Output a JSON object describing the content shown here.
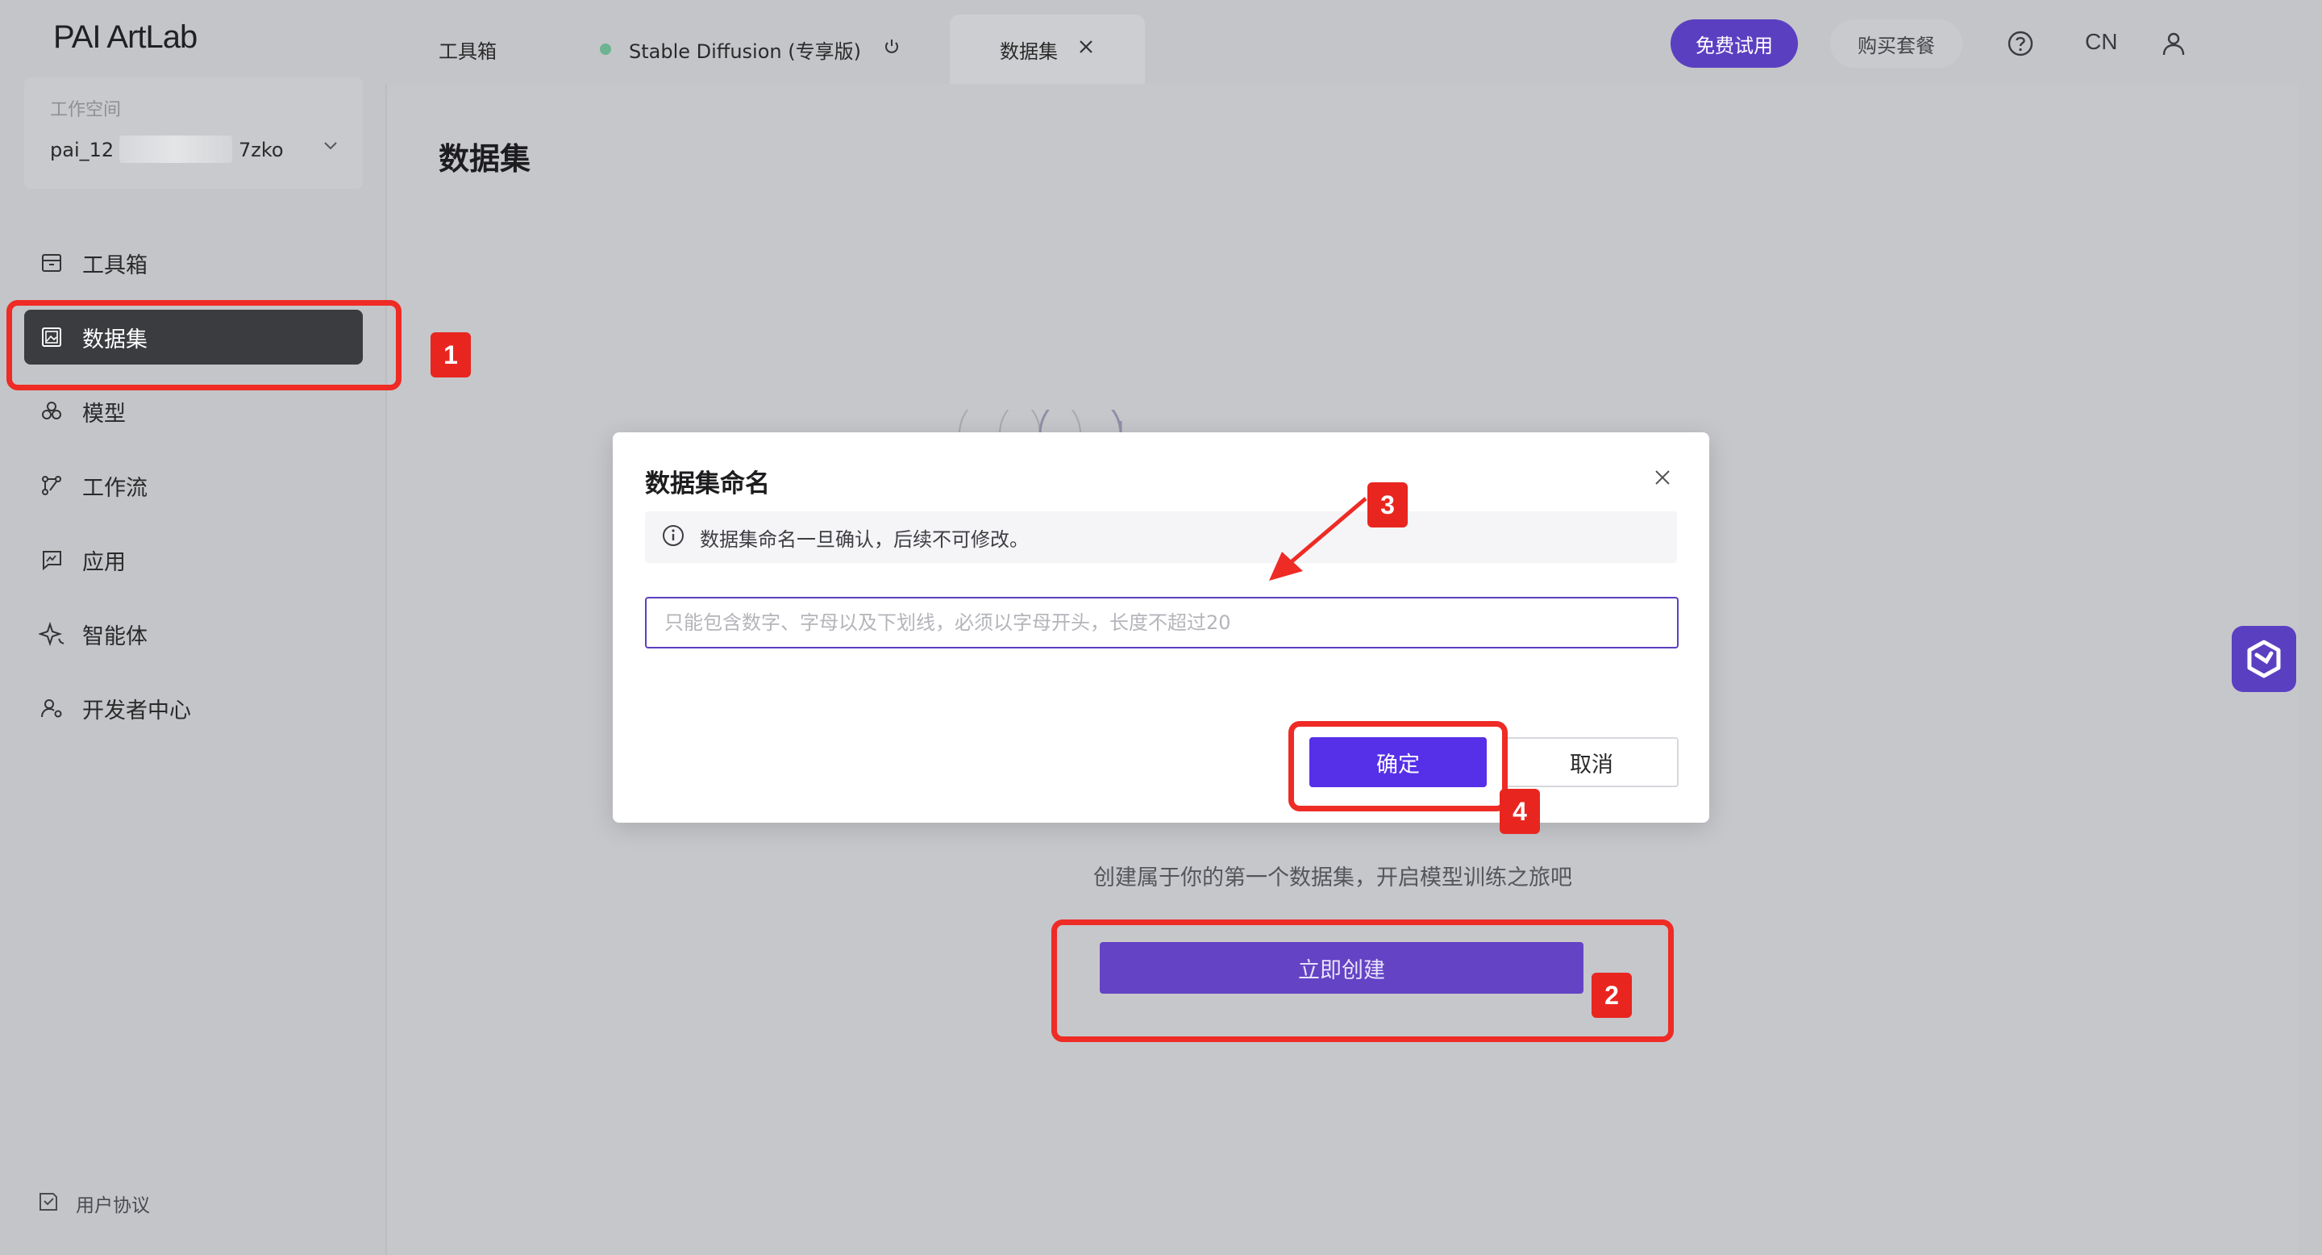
{
  "app": {
    "logo": "PAI ArtLab"
  },
  "workspace": {
    "label": "工作空间",
    "name_prefix": "pai_12",
    "name_suffix": "7zko"
  },
  "sidebar": {
    "items": [
      {
        "label": "工具箱",
        "icon": "toolbox-icon"
      },
      {
        "label": "数据集",
        "icon": "dataset-image-icon",
        "active": true
      },
      {
        "label": "模型",
        "icon": "model-icon"
      },
      {
        "label": "工作流",
        "icon": "workflow-icon"
      },
      {
        "label": "应用",
        "icon": "app-icon"
      },
      {
        "label": "智能体",
        "icon": "agent-sparkle-icon"
      },
      {
        "label": "开发者中心",
        "icon": "developer-icon"
      }
    ],
    "footer_link": "用户协议"
  },
  "topbar": {
    "tabs": [
      {
        "label": "工具箱"
      },
      {
        "label": "Stable Diffusion (专享版)",
        "status_color": "#6bb391"
      },
      {
        "label": "数据集",
        "active": true
      }
    ],
    "free_trial": "免费试用",
    "buy_plan": "购买套餐",
    "lang": "CN"
  },
  "main": {
    "page_title": "数据集",
    "empty_text": "创建属于你的第一个数据集，开启模型训练之旅吧",
    "create_button": "立即创建"
  },
  "modal": {
    "title": "数据集命名",
    "notice": "数据集命名一旦确认，后续不可修改。",
    "input_value": "",
    "input_placeholder": "只能包含数字、字母以及下划线，必须以字母开头，长度不超过20",
    "confirm": "确定",
    "cancel": "取消"
  },
  "annotations": {
    "badges": [
      "1",
      "2",
      "3",
      "4"
    ],
    "color": "#ee2b25"
  },
  "colors": {
    "accent": "#5b3fc1",
    "primary_button": "#5630e8"
  }
}
